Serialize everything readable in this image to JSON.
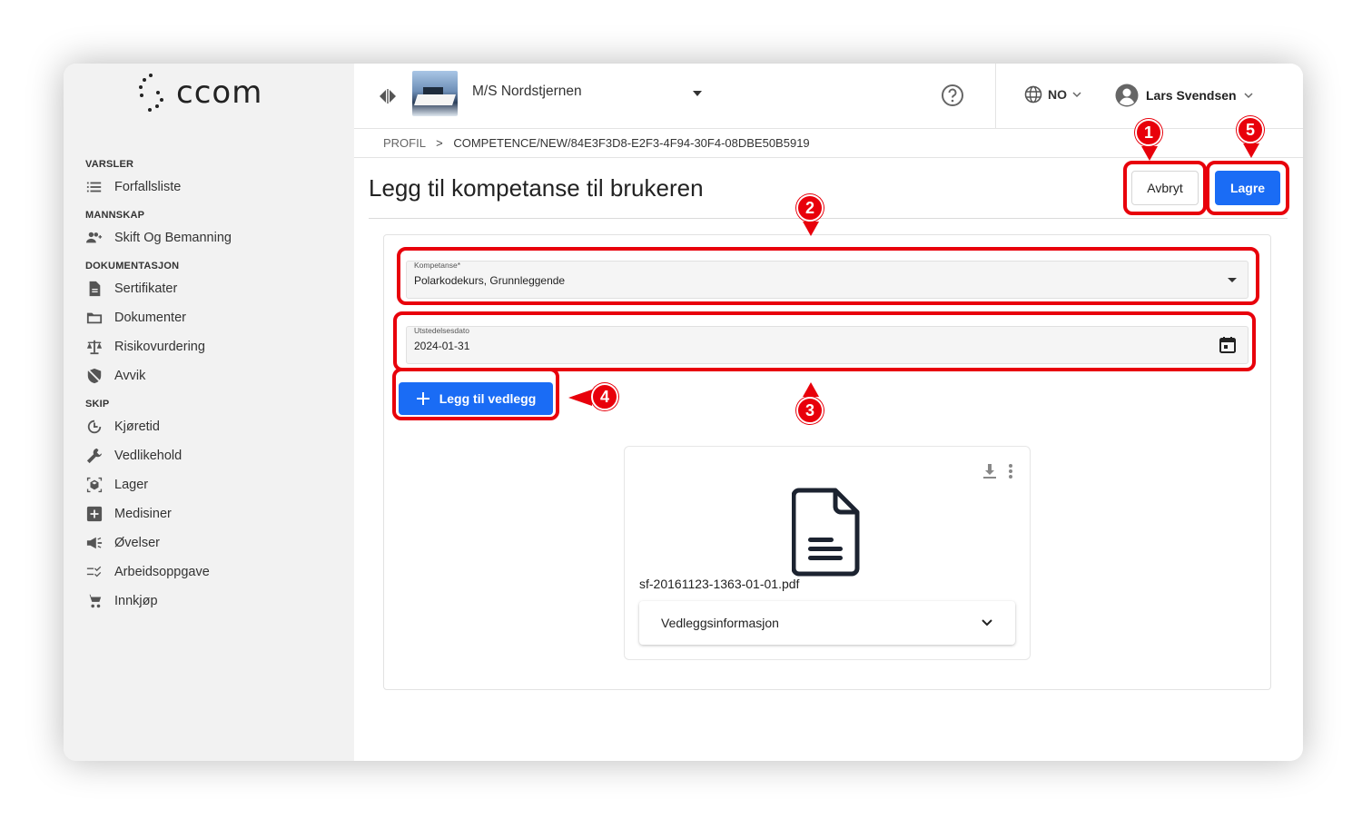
{
  "app": {
    "logo_text": "ccom"
  },
  "sidebar": {
    "sections": [
      {
        "title": "VARSLER",
        "items": [
          {
            "label": "Forfallsliste",
            "icon": "list-icon"
          }
        ]
      },
      {
        "title": "MANNSKAP",
        "items": [
          {
            "label": "Skift Og Bemanning",
            "icon": "people-icon"
          }
        ]
      },
      {
        "title": "DOKUMENTASJON",
        "items": [
          {
            "label": "Sertifikater",
            "icon": "document-icon"
          },
          {
            "label": "Dokumenter",
            "icon": "folder-icon"
          },
          {
            "label": "Risikovurdering",
            "icon": "scale-icon"
          },
          {
            "label": "Avvik",
            "icon": "shield-off-icon"
          }
        ]
      },
      {
        "title": "SKIP",
        "items": [
          {
            "label": "Kjøretid",
            "icon": "clock-icon"
          },
          {
            "label": "Vedlikehold",
            "icon": "wrench-icon"
          },
          {
            "label": "Lager",
            "icon": "box-icon"
          },
          {
            "label": "Medisiner",
            "icon": "medical-cross-icon"
          },
          {
            "label": "Øvelser",
            "icon": "megaphone-icon"
          },
          {
            "label": "Arbeidsoppgave",
            "icon": "checklist-icon"
          },
          {
            "label": "Innkjøp",
            "icon": "cart-icon"
          }
        ]
      }
    ]
  },
  "topbar": {
    "vessel_name": "M/S Nordstjernen",
    "language": "NO",
    "user_name": "Lars Svendsen"
  },
  "breadcrumb": {
    "home": "PROFIL",
    "separator": ">",
    "current": "COMPETENCE/NEW/84E3F3D8-E2F3-4F94-30F4-08DBE50B5919"
  },
  "page": {
    "title": "Legg til kompetanse til brukeren",
    "cancel_label": "Avbryt",
    "save_label": "Lagre"
  },
  "form": {
    "competence": {
      "label": "Kompetanse*",
      "value": "Polarkodekurs, Grunnleggende"
    },
    "issue_date": {
      "label": "Utstedelsesdato",
      "value": "2024-01-31"
    },
    "attach_label": "Legg til vedlegg"
  },
  "attachment": {
    "file_name": "sf-20161123-1363-01-01.pdf",
    "info_label": "Vedleggsinformasjon"
  },
  "annotations": {
    "badge_1": "1",
    "badge_2": "2",
    "badge_3": "3",
    "badge_4": "4",
    "badge_5": "5",
    "color": "#e8000b"
  },
  "colors": {
    "primary": "#1a6cf5",
    "sidebar_bg": "#f2f2f2"
  }
}
